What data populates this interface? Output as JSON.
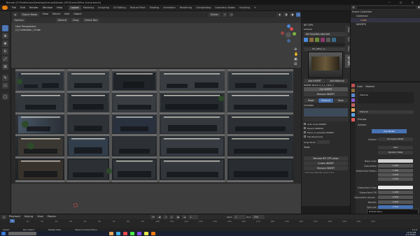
{
  "window": {
    "title": "Blender [F:\\Profile\\User\\Desktop\\Scenes\\Blender_INT\\Scene\\Office-Scene.blend]"
  },
  "menu": [
    "File",
    "Edit",
    "Render",
    "Window",
    "Help"
  ],
  "workspaces": [
    "Layout",
    "Modeling",
    "Sculpting",
    "UV Editing",
    "Texture Paint",
    "Shading",
    "Animation",
    "Rendering",
    "Compositing",
    "Geometry Nodes",
    "Scripting"
  ],
  "scene": {
    "name": "Scene",
    "view_layer": "ViewLayer"
  },
  "viewport": {
    "mode": "Object Mode",
    "menus": [
      "View",
      "Select",
      "Add",
      "Object"
    ],
    "orientation": "Global",
    "pivot": "Default",
    "drag": "Drag",
    "select_box": "Select Box",
    "options": "Options",
    "info_line1": "User Perspective",
    "info_line2": "(1) Collection | Cube"
  },
  "npanel": {
    "title": "BIT GPS",
    "section": "ATRACK",
    "tabs": [
      "Item",
      "Tool",
      "View",
      "BIT GPS"
    ],
    "favorites": "No Favorites selected",
    "asset_name": "HP_Office_0...",
    "add_insert": "Add INSERT",
    "add_material": "Add Material",
    "insert_name": "INSERT Name: P_4_L_right_1",
    "get_insert": "Get INSERT",
    "remove_insert": "Remove INSERT",
    "mode_tabs": [
      "Mode",
      "Material",
      "Tools"
    ],
    "controls_label": "Controls",
    "checkboxes": [
      "Auto scale INSERT",
      "Parent INSERTS",
      "Place on selected INSERT",
      "Flip Placement"
    ],
    "snap_mode_label": "Snap Mode",
    "tools_label": "Tools",
    "remove_btn": "Remove BIT GPS props",
    "btn_a": "Create INSERT",
    "btn_b": "Remove INSERT",
    "footer_note": "* will automatically save scene"
  },
  "outliner": {
    "header": "Scene Collection",
    "rows": [
      "Collection",
      "Cube",
      "INSERTS"
    ]
  },
  "properties": {
    "object_name": "Cube",
    "material_tab": "Material",
    "material_slot": "Material",
    "material_name": "Material",
    "sections": [
      "Preview",
      "Surface"
    ],
    "use_nodes": "Use Nodes",
    "surface_label": "Surface",
    "surface_value": "Principled BSDF",
    "distribution": "GGX",
    "subsurface_method": "Random Walk",
    "fields": [
      {
        "label": "Base Color",
        "value": ""
      },
      {
        "label": "Subsurface",
        "value": "0.000"
      },
      {
        "label": "Subsurface Radius",
        "value": "1.000"
      },
      {
        "label": "",
        "value": "0.200"
      },
      {
        "label": "",
        "value": "0.100"
      },
      {
        "label": "Subsurface Color",
        "value": ""
      },
      {
        "label": "Subsurface IOR",
        "value": "1.400"
      },
      {
        "label": "Subsurface Anisot...",
        "value": "0.000"
      },
      {
        "label": "Metallic",
        "value": "0.000"
      },
      {
        "label": "Specular",
        "value": "0.500"
      }
    ],
    "tooltip_title": "Default Value",
    "tooltip_body": "Input value used for unconnected socket"
  },
  "timeline": {
    "menus": [
      "Playback",
      "Keying",
      "View",
      "Marker"
    ],
    "start_label": "Start",
    "start": "1",
    "end_label": "End",
    "end": "250",
    "current": "1",
    "ticks": [
      "0",
      "10",
      "20",
      "30",
      "40",
      "50",
      "60",
      "70",
      "80",
      "90",
      "100",
      "110",
      "120",
      "130",
      "140",
      "150",
      "160",
      "170",
      "180",
      "190",
      "200",
      "210",
      "220",
      "230",
      "240",
      "250"
    ]
  },
  "statusbar": {
    "select": "Select",
    "box_select": "Box Select",
    "rotate": "Rotate View",
    "context": "Object Context Menu",
    "version": "3.0.0"
  },
  "taskbar": {
    "time": "12:22 PM",
    "date": "4/17/2022"
  },
  "colors": {
    "accent": "#4772b3",
    "viewport_bg": "#3d3d3d",
    "panel_bg": "#2b2b2b",
    "active_tool": "#4772b3"
  }
}
